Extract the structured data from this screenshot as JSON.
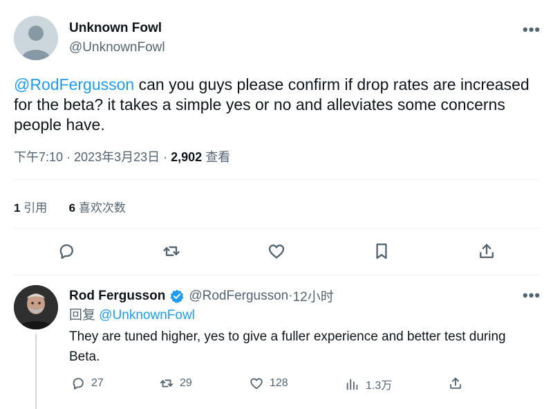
{
  "tweet": {
    "author_name": "Unknown Fowl",
    "author_handle": "@UnknownFowl",
    "more_label": "•••",
    "mention": "@RodFergusson",
    "text": " can you guys please confirm if drop rates are increased for the beta? it takes a simple yes or no and alleviates some concerns people have.",
    "time": "下午7:10",
    "separator": " · ",
    "date": "2023年3月23日",
    "views_count": "2,902",
    "views_label": "查看",
    "quotes_count": "1",
    "quotes_label": "引用",
    "likes_count": "6",
    "likes_label": "喜欢次数",
    "actions": [
      "reply-icon",
      "retweet-icon",
      "like-icon",
      "bookmark-icon",
      "share-icon"
    ]
  },
  "reply": {
    "author_name": "Rod Fergusson",
    "author_handle": "@RodFergusson",
    "age": "12小时",
    "separator": " · ",
    "more_label": "•••",
    "replying_to_prefix": "回复 ",
    "replying_to": "@UnknownFowl",
    "text": "They are tuned higher, yes to give a fuller experience and better test during Beta.",
    "replies": "27",
    "retweets": "29",
    "likes": "128",
    "views": "1.3万",
    "verified_color": "#1d9bf0"
  },
  "colors": {
    "link": "#1d9bf0",
    "secondary_text": "#536471",
    "primary_text": "#0f1419",
    "divider": "#eff3f4"
  }
}
